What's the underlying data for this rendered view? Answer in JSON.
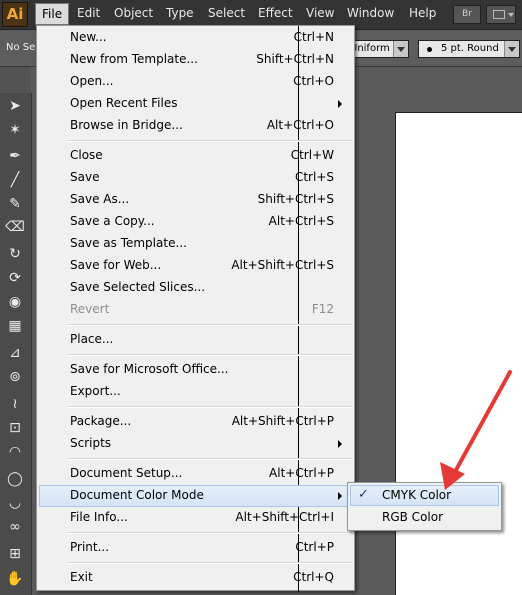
{
  "app": {
    "logo": "Ai"
  },
  "menubar": {
    "items": [
      "File",
      "Edit",
      "Object",
      "Type",
      "Select",
      "Effect",
      "View",
      "Window",
      "Help"
    ],
    "bridge_label": "Br"
  },
  "controlbar": {
    "selection_status": "No Se",
    "variable_width_profile": "Uniform",
    "brush_definition": "5 pt. Round"
  },
  "file_menu": {
    "items": [
      {
        "label": "New...",
        "shortcut": "Ctrl+N"
      },
      {
        "label": "New from Template...",
        "shortcut": "Shift+Ctrl+N"
      },
      {
        "label": "Open...",
        "shortcut": "Ctrl+O"
      },
      {
        "label": "Open Recent Files",
        "shortcut": ""
      },
      {
        "label": "Browse in Bridge...",
        "shortcut": "Alt+Ctrl+O"
      },
      {
        "label": "Close",
        "shortcut": "Ctrl+W"
      },
      {
        "label": "Save",
        "shortcut": "Ctrl+S"
      },
      {
        "label": "Save As...",
        "shortcut": "Shift+Ctrl+S"
      },
      {
        "label": "Save a Copy...",
        "shortcut": "Alt+Ctrl+S"
      },
      {
        "label": "Save as Template...",
        "shortcut": ""
      },
      {
        "label": "Save for Web...",
        "shortcut": "Alt+Shift+Ctrl+S"
      },
      {
        "label": "Save Selected Slices...",
        "shortcut": ""
      },
      {
        "label": "Revert",
        "shortcut": "F12"
      },
      {
        "label": "Place...",
        "shortcut": ""
      },
      {
        "label": "Save for Microsoft Office...",
        "shortcut": ""
      },
      {
        "label": "Export...",
        "shortcut": ""
      },
      {
        "label": "Package...",
        "shortcut": "Alt+Shift+Ctrl+P"
      },
      {
        "label": "Scripts",
        "shortcut": ""
      },
      {
        "label": "Document Setup...",
        "shortcut": "Alt+Ctrl+P"
      },
      {
        "label": "Document Color Mode",
        "shortcut": ""
      },
      {
        "label": "File Info...",
        "shortcut": "Alt+Shift+Ctrl+I"
      },
      {
        "label": "Print...",
        "shortcut": "Ctrl+P"
      },
      {
        "label": "Exit",
        "shortcut": "Ctrl+Q"
      }
    ]
  },
  "color_mode_submenu": {
    "items": [
      {
        "label": "CMYK Color",
        "checked": true
      },
      {
        "label": "RGB Color",
        "checked": false
      }
    ],
    "check_glyph": "✓"
  },
  "colors": {
    "annotation_arrow": "#e53935",
    "highlight": "#d4e3f6",
    "app_accent": "#f3a434"
  },
  "icons": [
    "selection-tool",
    "magic-wand-tool",
    "pen-tool",
    "line-tool",
    "paintbrush-tool",
    "eraser-tool",
    "rotate-tool",
    "warp-tool",
    "shape-builder-tool",
    "perspective-grid-tool",
    "eyedropper-tool",
    "symbol-sprayer-tool",
    "width-tool",
    "free-transform-tool",
    "gradient-tool",
    "lasso-tool",
    "blob-tool",
    "slice-tool",
    "artboard-tool",
    "hand-tool"
  ]
}
